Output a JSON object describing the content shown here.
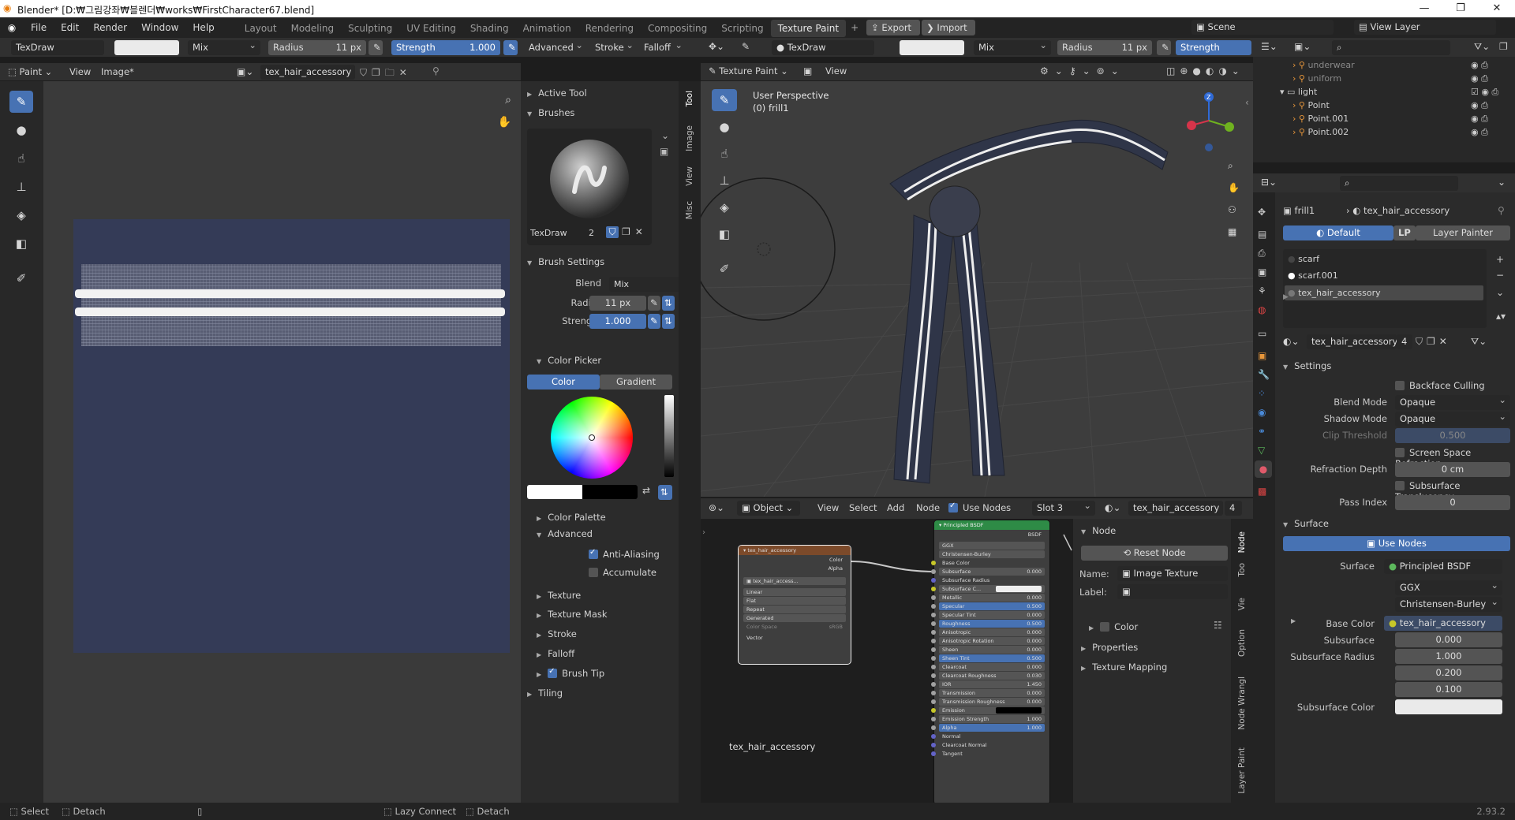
{
  "title": "Blender* [D:₩그림강좌₩블렌더₩works₩FirstCharacter67.blend]",
  "window_buttons": [
    "—",
    "❐",
    "✕"
  ],
  "menu": [
    "File",
    "Edit",
    "Render",
    "Window",
    "Help"
  ],
  "workspaces": [
    "Layout",
    "Modeling",
    "Sculpting",
    "UV Editing",
    "Shading",
    "Animation",
    "Rendering",
    "Compositing",
    "Scripting",
    "Texture Paint"
  ],
  "export_label": "Export",
  "import_label": "Import",
  "scene": "Scene",
  "view_layer": "View Layer",
  "left_header": {
    "brush": "TexDraw",
    "blend": "Mix",
    "radius_label": "Radius",
    "radius": "11 px",
    "strength_label": "Strength",
    "strength": "1.000",
    "advanced": "Advanced",
    "stroke": "Stroke",
    "falloff": "Falloff"
  },
  "left_sub": {
    "mode": "Paint",
    "view": "View",
    "image": "Image*",
    "image_name": "tex_hair_accessory"
  },
  "props_panel": {
    "active_tool": "Active Tool",
    "brushes": "Brushes",
    "brush_name": "TexDraw",
    "brush_users": "2",
    "brush_settings": "Brush Settings",
    "blend_label": "Blend",
    "blend": "Mix",
    "radius_label": "Radius",
    "radius": "11 px",
    "strength_label": "Strength",
    "strength": "1.000",
    "color_picker": "Color Picker",
    "color_tab": "Color",
    "gradient_tab": "Gradient",
    "color_palette": "Color Palette",
    "advanced": "Advanced",
    "anti_aliasing": "Anti-Aliasing",
    "accumulate": "Accumulate",
    "texture": "Texture",
    "texture_mask": "Texture Mask",
    "stroke": "Stroke",
    "falloff": "Falloff",
    "brush_tip": "Brush Tip",
    "tiling": "Tiling"
  },
  "side_tabs": [
    "Tool",
    "Image",
    "View",
    "Misc"
  ],
  "viewport_header": {
    "brush": "TexDraw",
    "blend": "Mix",
    "radius_label": "Radius",
    "radius": "11 px",
    "strength_label": "Strength",
    "mode": "Texture Paint",
    "view": "View"
  },
  "viewport": {
    "perspective": "User Perspective",
    "object": "(0) frill1"
  },
  "node_header": {
    "object": "Object",
    "view": "View",
    "select": "Select",
    "add": "Add",
    "node": "Node",
    "use_nodes": "Use Nodes",
    "slot": "Slot 3",
    "material": "tex_hair_accessory",
    "users": "4"
  },
  "image_node": {
    "title": "tex_hair_accessory",
    "out_color": "Color",
    "out_alpha": "Alpha",
    "image": "tex_hair_access...",
    "interp": "Linear",
    "proj": "Flat",
    "ext": "Repeat",
    "source": "Generated",
    "colorspace": "Color Space",
    "colorspace_val": "sRGB",
    "vector": "Vector"
  },
  "bsdf_node": {
    "title": "Principled BSDF",
    "bsdf": "BSDF",
    "dist": "GGX",
    "sss": "Christensen-Burley",
    "rows": [
      [
        "Base Color",
        ""
      ],
      [
        "Subsurface",
        "0.000"
      ],
      [
        "Subsurface Radius",
        ""
      ],
      [
        "Subsurface C...",
        ""
      ],
      [
        "Metallic",
        "0.000"
      ],
      [
        "Specular",
        "0.500"
      ],
      [
        "Specular Tint",
        "0.000"
      ],
      [
        "Roughness",
        "0.500"
      ],
      [
        "Anisotropic",
        "0.000"
      ],
      [
        "Anisotropic Rotation",
        "0.000"
      ],
      [
        "Sheen",
        "0.000"
      ],
      [
        "Sheen Tint",
        "0.500"
      ],
      [
        "Clearcoat",
        "0.000"
      ],
      [
        "Clearcoat Roughness",
        "0.030"
      ],
      [
        "IOR",
        "1.450"
      ],
      [
        "Transmission",
        "0.000"
      ],
      [
        "Transmission Roughness",
        "0.000"
      ],
      [
        "Emission",
        ""
      ],
      [
        "Emission Strength",
        "1.000"
      ],
      [
        "Alpha",
        "1.000"
      ],
      [
        "Normal",
        ""
      ],
      [
        "Clearcoat Normal",
        ""
      ],
      [
        "Tangent",
        ""
      ]
    ]
  },
  "node_canvas_label": "tex_hair_accessory",
  "node_sidebar": {
    "node": "Node",
    "reset": "Reset Node",
    "name_label": "Name:",
    "name": "Image Texture",
    "label_label": "Label:",
    "color": "Color",
    "properties": "Properties",
    "texture_mapping": "Texture Mapping"
  },
  "node_side_tabs": [
    "Node",
    "Too",
    "Vie",
    "Option",
    "Node Wrangl",
    "Layer Paint"
  ],
  "outliner": [
    {
      "name": "underwear",
      "indent": 2
    },
    {
      "name": "uniform",
      "indent": 2
    },
    {
      "name": "light",
      "indent": 1
    },
    {
      "name": "Point",
      "indent": 2
    },
    {
      "name": "Point.001",
      "indent": 2
    },
    {
      "name": "Point.002",
      "indent": 2
    }
  ],
  "props": {
    "object": "frill1",
    "material": "tex_hair_accessory",
    "tabs": [
      "Default",
      "LP",
      "Layer Painter"
    ],
    "slots": [
      "scarf",
      "scarf.001",
      "tex_hair_accessory"
    ],
    "mat_name": "tex_hair_accessory",
    "mat_users": "4",
    "settings": "Settings",
    "backface": "Backface Culling",
    "blend_mode_label": "Blend Mode",
    "blend_mode": "Opaque",
    "shadow_mode_label": "Shadow Mode",
    "shadow_mode": "Opaque",
    "clip_label": "Clip Threshold",
    "clip": "0.500",
    "ssr": "Screen Space Refraction",
    "refr_label": "Refraction Depth",
    "refr": "0 cm",
    "sst": "Subsurface Translucency",
    "pass_label": "Pass Index",
    "pass": "0",
    "surface": "Surface",
    "use_nodes": "Use Nodes",
    "surface_label": "Surface",
    "surface_val": "Principled BSDF",
    "ggx": "GGX",
    "cb": "Christensen-Burley",
    "base_color_label": "Base Color",
    "base_color": "tex_hair_accessory",
    "subsurface_label": "Subsurface",
    "subsurface": "0.000",
    "ssr_label": "Subsurface Radius",
    "ssr1": "1.000",
    "ssr2": "0.200",
    "ssr3": "0.100",
    "ssc_label": "Subsurface Color"
  },
  "status": {
    "select": "Select",
    "detach": "Detach",
    "lazy": "Lazy Connect",
    "detach2": "Detach",
    "version": "2.93.2"
  },
  "colors": {
    "accent": "#4772b3",
    "bg": "#303030",
    "canvas_bg": "#343b57"
  }
}
